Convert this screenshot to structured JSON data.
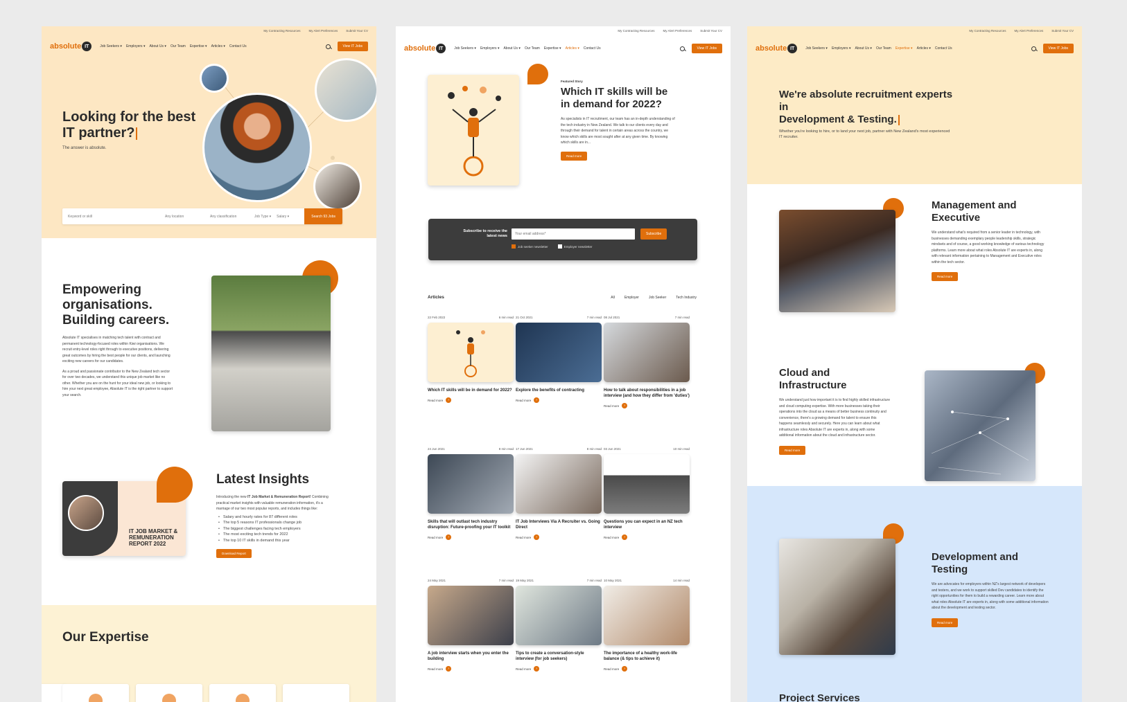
{
  "colors": {
    "accent": "#e06f0c",
    "cream": "#fde7c3",
    "pale_cream": "#fdf2d4",
    "pale_blue": "#d6e7fb",
    "dark": "#3c3c3c"
  },
  "utility_links": [
    "My Contracting Resources",
    "My Alert Preferences",
    "Submit Your CV"
  ],
  "logo": {
    "text": "absolute",
    "badge": "IT"
  },
  "nav_links": [
    "Job Seekers ▾",
    "Employers ▾",
    "About Us ▾",
    "Our Team",
    "Expertise ▾",
    "Articles ▾",
    "Contact Us"
  ],
  "view_jobs_label": "View IT Jobs",
  "page1": {
    "hero_title": "Looking for the best IT partner?",
    "hero_sub": "The answer is absolute.",
    "search": {
      "keyword": "Keyword or skill",
      "location": "Any location",
      "classification": "Any classification",
      "job_type": "Job Type ▾",
      "salary": "Salary ▾",
      "button": "Search 93 Jobs"
    },
    "empower_title": "Empowering organisations. Building careers.",
    "empower_p1": "Absolute IT specialises in matching tech talent with contract and permanent technology-focused roles within Kiwi organisations. We recruit entry-level roles right through to executive positions, delivering great outcomes by hiring the best people for our clients, and launching exciting new careers for our candidates.",
    "empower_p2": "As a proud and passionate contributor to the New Zealand tech sector for over two decades, we understand this unique job market like no other. Whether you are on the hunt for your ideal new job, or looking to hire your next great employee, Absolute IT is the right partner to support your search.",
    "report_label": "IT JOB MARKET & REMUNERATION REPORT 2022",
    "insights_title": "Latest Insights",
    "insights_intro_a": "Introducing the new ",
    "insights_intro_b": "IT Job Market & Remuneration Report!",
    "insights_intro_c": " Combining practical market insights with valuable remuneration information, it's a marriage of our two most popular reports, and includes things like:",
    "insights_bullets": [
      "Salary and hourly rates for 87 different roles",
      "The top 5 reasons IT professionals change job",
      "The biggest challenges facing tech employers",
      "The most exciting tech trends for 2022",
      "The top 10 IT skills in demand this year"
    ],
    "download_label": "Download Report",
    "expertise_title": "Our Expertise"
  },
  "page2": {
    "featured_label": "Featured Story",
    "featured_title": "Which IT skills will be in demand for 2022?",
    "featured_body": "As specialists in IT recruitment, our team has an in-depth understanding of the tech industry in New Zealand. We talk to our clients every day and through their demand for talent in certain areas across the country, we know which skills are most sought after at any given time. By knowing which skills are in...",
    "read_more": "Read more",
    "subscribe_label": "Subscribe to receive the latest news",
    "email_placeholder": "Your email address*",
    "subscribe_button": "Subscribe",
    "check_jobseeker": "Job seeker newsletter",
    "check_employer": "Employer newsletter",
    "articles_heading": "Articles",
    "filters": [
      "All",
      "Employer",
      "Job Seeker",
      "Tech Industry"
    ],
    "articles": [
      {
        "date": "22 Feb 2022",
        "read": "6 min read",
        "title": "Which IT skills will be in demand for 2022?"
      },
      {
        "date": "21 Oct 2021",
        "read": "7 min read",
        "title": "Explore the benefits of contracting"
      },
      {
        "date": "08 Jul 2021",
        "read": "7 min read",
        "title": "How to talk about responsibilities in a job interview (and how they differ from 'duties')"
      },
      {
        "date": "24 Jun 2021",
        "read": "8 min read",
        "title": "Skills that will outlast tech industry disruption: Future-proofing your IT toolkit"
      },
      {
        "date": "17 Jun 2021",
        "read": "8 min read",
        "title": "IT Job Interviews Via A Recruiter vs. Going Direct"
      },
      {
        "date": "03 Jun 2021",
        "read": "10 min read",
        "title": "Questions you can expect in an NZ tech interview"
      },
      {
        "date": "24 May 2021",
        "read": "7 min read",
        "title": "A job interview starts when you enter the building"
      },
      {
        "date": "19 May 2021",
        "read": "7 min read",
        "title": "Tips to create a conversation-style interview (for job seekers)"
      },
      {
        "date": "10 May 2021",
        "read": "14 min read",
        "title": "The importance of a healthy work-life balance (& tips to achieve it)"
      }
    ]
  },
  "page3": {
    "hero_title_a": "We're absolute recruitment experts in",
    "hero_title_b": "Development & Testing.",
    "hero_sub": "Whether you're looking to hire, or to land your next job, partner with New Zealand's most experienced IT recruiter.",
    "mgmt_title": "Management and Executive",
    "mgmt_body": "We understand what's required from a senior leader in technology, with businesses demanding exemplary people leadership skills, strategic mindsets and of course, a good working knowledge of various technology platforms. Learn more about what roles Absolute IT are experts in, along with relevant information pertaining to Management and Executive roles within the tech sector.",
    "cloud_title": "Cloud and Infrastructure",
    "cloud_body": "We understand just how important it is to find highly skilled infrastructure and cloud computing expertise. With more businesses taking their operations into the cloud as a means of better business continuity and convenience, there's a growing demand for talent to ensure this happens seamlessly and securely. Here you can learn about what infrastructure roles Absolute IT are experts in, along with some additional information about the cloud and infrastructure sector.",
    "dev_title": "Development and Testing",
    "dev_body": "We are advocates for employers within NZ's largest network of developers and testers, and we work to support skilled Dev candidates to identify the right opportunities for them to build a rewarding career. Learn more about what roles Absolute IT are experts in, along with some additional information about the development and testing sector.",
    "project_title": "Project Services",
    "read_more": "Read more"
  }
}
